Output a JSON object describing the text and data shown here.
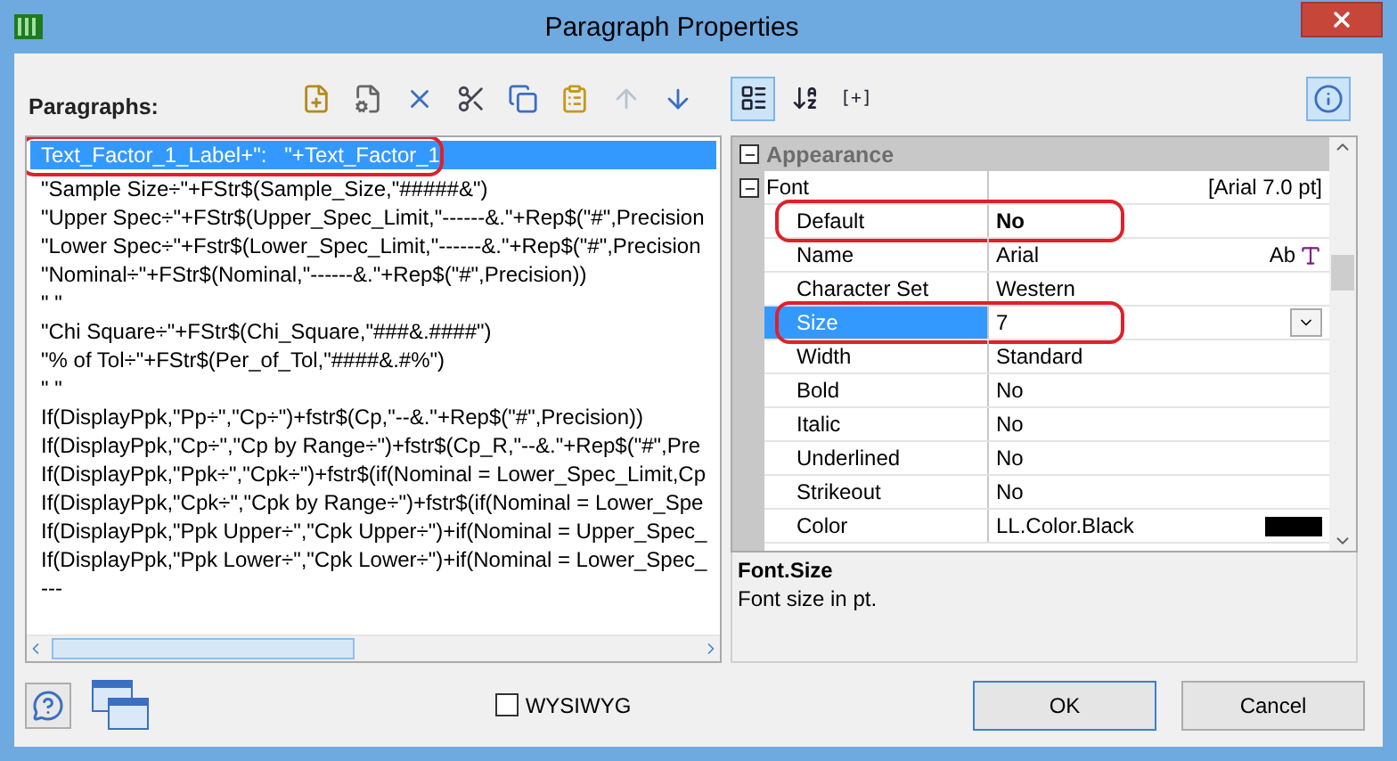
{
  "window": {
    "title": "Paragraph Properties"
  },
  "paragraphs": {
    "label": "Paragraphs:",
    "toolbar": [
      {
        "kind": "new",
        "disabled": false
      },
      {
        "kind": "properties",
        "disabled": false
      },
      {
        "kind": "delete",
        "disabled": false
      },
      {
        "kind": "cut",
        "disabled": false
      },
      {
        "kind": "copy",
        "disabled": false
      },
      {
        "kind": "paste",
        "disabled": false
      },
      {
        "kind": "up",
        "disabled": true
      },
      {
        "kind": "down",
        "disabled": false
      }
    ],
    "lines": [
      {
        "text": "Text_Factor_1_Label+\":   \"+Text_Factor_1",
        "selected": true,
        "circled": true
      },
      {
        "text": "\"Sample Size÷\"+FStr$(Sample_Size,\"#####&\")",
        "selected": false,
        "circled": false
      },
      {
        "text": "\"Upper Spec÷\"+FStr$(Upper_Spec_Limit,\"------&.\"+Rep$(\"#\",Precision",
        "selected": false,
        "circled": false
      },
      {
        "text": "\"Lower Spec÷\"+Fstr$(Lower_Spec_Limit,\"------&.\"+Rep$(\"#\",Precision",
        "selected": false,
        "circled": false
      },
      {
        "text": "\"Nominal÷\"+FStr$(Nominal,\"------&.\"+Rep$(\"#\",Precision))",
        "selected": false,
        "circled": false
      },
      {
        "text": "\" \"",
        "selected": false,
        "circled": false
      },
      {
        "text": "\"Chi Square÷\"+FStr$(Chi_Square,\"###&.####\")",
        "selected": false,
        "circled": false
      },
      {
        "text": "\"% of Tol÷\"+FStr$(Per_of_Tol,\"####&.#%\")",
        "selected": false,
        "circled": false
      },
      {
        "text": "\" \"",
        "selected": false,
        "circled": false
      },
      {
        "text": "If(DisplayPpk,\"Pp÷\",\"Cp÷\")+fstr$(Cp,\"--&.\"+Rep$(\"#\",Precision))",
        "selected": false,
        "circled": false
      },
      {
        "text": "If(DisplayPpk,\"Cp÷\",\"Cp by Range÷\")+fstr$(Cp_R,\"--&.\"+Rep$(\"#\",Pre",
        "selected": false,
        "circled": false
      },
      {
        "text": "If(DisplayPpk,\"Ppk÷\",\"Cpk÷\")+fstr$(if(Nominal = Lower_Spec_Limit,Cp",
        "selected": false,
        "circled": false
      },
      {
        "text": "If(DisplayPpk,\"Cpk÷\",\"Cpk by Range÷\")+fstr$(if(Nominal = Lower_Spe",
        "selected": false,
        "circled": false
      },
      {
        "text": "If(DisplayPpk,\"Ppk Upper÷\",\"Cpk Upper÷\")+if(Nominal = Upper_Spec_",
        "selected": false,
        "circled": false
      },
      {
        "text": "If(DisplayPpk,\"Ppk Lower÷\",\"Cpk Lower÷\")+if(Nominal = Lower_Spec_",
        "selected": false,
        "circled": false
      },
      {
        "text": "---",
        "selected": false,
        "circled": false
      }
    ]
  },
  "properties": {
    "toolbar": [
      {
        "kind": "categorized",
        "selected": true
      },
      {
        "kind": "alphabetical",
        "selected": false
      },
      {
        "kind": "expand",
        "text": "[+]",
        "selected": false
      }
    ],
    "info": {
      "selected": true
    },
    "category": {
      "name": "Appearance",
      "expanded": true,
      "group": {
        "name": "Font",
        "value": "[Arial 7.0 pt]",
        "expanded": true,
        "rows": [
          {
            "name": "Default",
            "value": "No",
            "kind": "text",
            "modified": true,
            "selected": false,
            "circled": true
          },
          {
            "name": "Name",
            "value": "Arial",
            "kind": "font",
            "icon_text": "Ab",
            "modified": false,
            "selected": false,
            "circled": false
          },
          {
            "name": "Character Set",
            "value": "Western",
            "kind": "text",
            "modified": false,
            "selected": false,
            "circled": false
          },
          {
            "name": "Size",
            "value": "7",
            "kind": "dropdown",
            "modified": false,
            "selected": true,
            "circled": true
          },
          {
            "name": "Width",
            "value": "Standard",
            "kind": "text",
            "modified": false,
            "selected": false,
            "circled": false
          },
          {
            "name": "Bold",
            "value": "No",
            "kind": "text",
            "modified": false,
            "selected": false,
            "circled": false
          },
          {
            "name": "Italic",
            "value": "No",
            "kind": "text",
            "modified": false,
            "selected": false,
            "circled": false
          },
          {
            "name": "Underlined",
            "value": "No",
            "kind": "text",
            "modified": false,
            "selected": false,
            "circled": false
          },
          {
            "name": "Strikeout",
            "value": "No",
            "kind": "text",
            "modified": false,
            "selected": false,
            "circled": false
          },
          {
            "name": "Color",
            "value": "LL.Color.Black",
            "kind": "color",
            "color": "#000000",
            "modified": false,
            "selected": false,
            "circled": false
          }
        ]
      }
    },
    "description": {
      "title": "Font.Size",
      "text": "Font size in pt."
    }
  },
  "footer": {
    "wysiwyg": {
      "label": "WYSIWYG",
      "checked": false
    },
    "buttons": [
      {
        "label": "OK",
        "default": true
      },
      {
        "label": "Cancel",
        "default": false
      }
    ]
  }
}
